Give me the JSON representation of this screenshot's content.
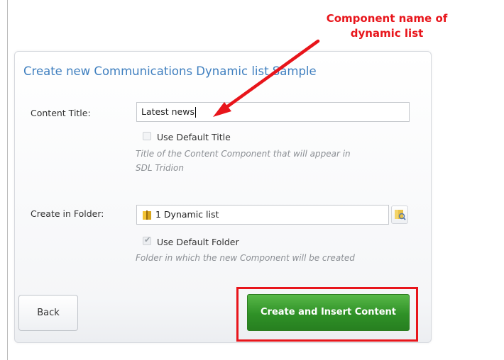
{
  "annotation": {
    "line1": "Component name of",
    "line2": "dynamic list",
    "color": "#e8151b"
  },
  "dialog": {
    "title": "Create new Communications Dynamic list Sample",
    "content_title": {
      "label": "Content Title:",
      "value": "Latest news",
      "use_default_label": "Use Default Title",
      "use_default_checked": false,
      "hint_line1": "Title of the Content Component that will appear in",
      "hint_line2": "SDL Tridion"
    },
    "folder": {
      "label": "Create in Folder:",
      "value": "1 Dynamic list",
      "icon": "folder-icon",
      "browse_icon": "folder-browse-icon",
      "use_default_label": "Use Default Folder",
      "use_default_checked": true,
      "hint": "Folder in which the new Component will be created"
    },
    "buttons": {
      "back": "Back",
      "create": "Create and Insert Content"
    }
  },
  "colors": {
    "title_blue": "#3f7fbf",
    "primary_green": "#2f9127",
    "highlight_red": "#e8151b"
  }
}
